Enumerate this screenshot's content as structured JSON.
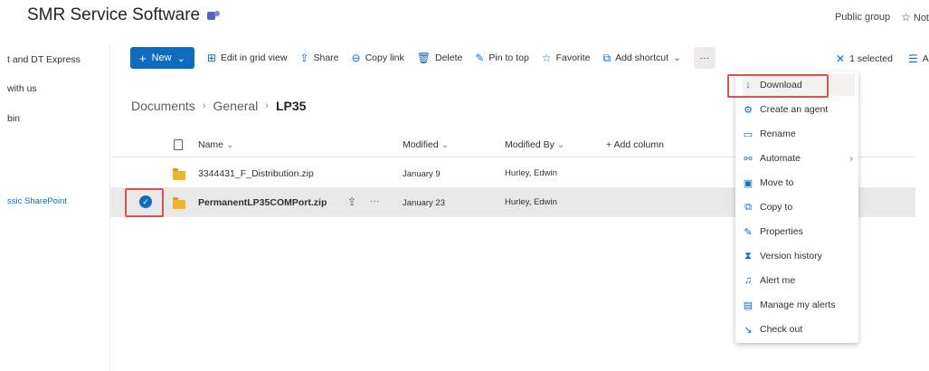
{
  "site": {
    "title": "SMR Service Software",
    "group": "Public group",
    "follow": "Not"
  },
  "leftnav": {
    "items": [
      "t and DT Express",
      "with us",
      "bin"
    ],
    "link": "ssic SharePoint"
  },
  "toolbar": {
    "new": "New",
    "edit_grid": "Edit in grid view",
    "share": "Share",
    "copy_link": "Copy link",
    "delete": "Delete",
    "pin": "Pin to top",
    "favorite": "Favorite",
    "add_shortcut": "Add shortcut",
    "more": "···",
    "selected": "1 selected",
    "right_cut": "A"
  },
  "breadcrumb": {
    "items": [
      "Documents",
      "General"
    ],
    "current": "LP35"
  },
  "columns": {
    "name": "Name",
    "modified": "Modified",
    "modified_by": "Modified By",
    "add": "+ Add column"
  },
  "rows": [
    {
      "name": "3344431_F_Distribution.zip",
      "modified": "January 9",
      "modified_by": "Hurley, Edwin",
      "selected": false
    },
    {
      "name": "PermanentLP35COMPort.zip",
      "modified": "January 23",
      "modified_by": "Hurley, Edwin",
      "selected": true
    }
  ],
  "context_menu": [
    {
      "label": "Download",
      "icon": "download-icon"
    },
    {
      "label": "Create an agent",
      "icon": "agent-icon"
    },
    {
      "label": "Rename",
      "icon": "rename-icon"
    },
    {
      "label": "Automate",
      "icon": "automate-icon",
      "submenu": true
    },
    {
      "label": "Move to",
      "icon": "move-icon"
    },
    {
      "label": "Copy to",
      "icon": "copy-icon"
    },
    {
      "label": "Properties",
      "icon": "pencil-icon"
    },
    {
      "label": "Version history",
      "icon": "version-icon"
    },
    {
      "label": "Alert me",
      "icon": "bell-icon"
    },
    {
      "label": "Manage my alerts",
      "icon": "manage-alerts-icon"
    },
    {
      "label": "Check out",
      "icon": "checkout-icon"
    }
  ],
  "colors": {
    "accent": "#0f6cbd",
    "highlight": "#d9534f"
  }
}
